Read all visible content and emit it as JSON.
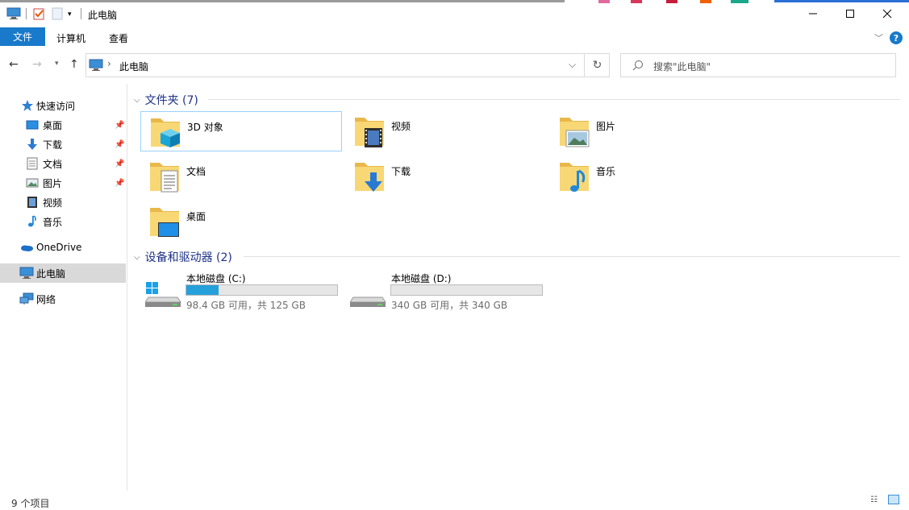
{
  "window": {
    "title": "此电脑",
    "minimize_icon": "minimize-icon",
    "maximize_icon": "maximize-icon",
    "close_icon": "close-icon"
  },
  "ribbon": {
    "tabs": [
      "文件",
      "计算机",
      "查看"
    ],
    "help_label": "?"
  },
  "address_bar": {
    "path": "此电脑",
    "search_placeholder": "搜索\"此电脑\""
  },
  "sidebar": {
    "quick_access": "快速访问",
    "pinned": [
      "桌面",
      "下载",
      "文档",
      "图片"
    ],
    "unpinned": [
      "视频",
      "音乐"
    ],
    "onedrive": "OneDrive",
    "this_pc": "此电脑",
    "network": "网络"
  },
  "folders": {
    "heading": "文件夹 (7)",
    "items": [
      "3D 对象",
      "视频",
      "图片",
      "文档",
      "下载",
      "音乐",
      "桌面"
    ]
  },
  "drives": {
    "heading": "设备和驱动器 (2)",
    "items": [
      {
        "name": "本地磁盘 (C:)",
        "detail": "98.4 GB 可用，共 125 GB",
        "used_fraction": 0.213
      },
      {
        "name": "本地磁盘 (D:)",
        "detail": "340 GB 可用，共 340 GB",
        "used_fraction": 0.0
      }
    ]
  },
  "status": {
    "count": "9 个项目"
  },
  "colors": {
    "accent": "#1979ca",
    "drive_bar": "#26a0da",
    "heading": "#1e3287",
    "folder": "#f8d775"
  }
}
